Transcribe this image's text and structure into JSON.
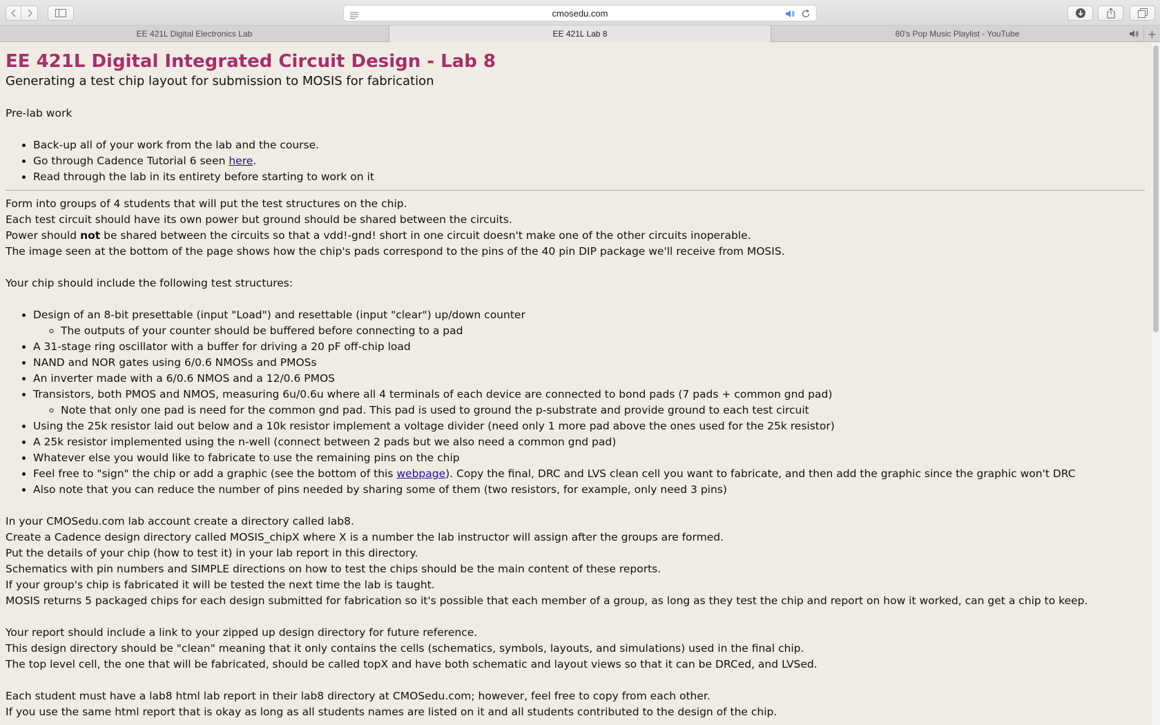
{
  "browser": {
    "url": "cmosedu.com",
    "icons": [
      "back-arrow-icon",
      "forward-arrow-icon",
      "sidebar-icon",
      "reader-icon",
      "audio-icon",
      "reload-icon",
      "download-icon",
      "share-icon",
      "tabs-overview-icon"
    ]
  },
  "tabs": [
    {
      "label": "EE 421L Digital Electronics Lab",
      "active": false
    },
    {
      "label": "EE 421L Lab 8",
      "active": true
    },
    {
      "label": "80's Pop Music Playlist - YouTube",
      "active": false,
      "audio": true
    }
  ],
  "page": {
    "title": "EE 421L Digital Integrated Circuit Design - Lab 8",
    "subtitle": "Generating a test chip layout for submission to MOSIS for fabrication",
    "prelab_heading": "Pre-lab work",
    "prelab_items": {
      "i0": "Back-up all of your work from the lab and the course.",
      "i1_pre": "Go through Cadence Tutorial 6 seen ",
      "i1_link": "here",
      "i1_post": ".",
      "i2": "Read through the lab in its entirety before starting to work on it"
    },
    "para1": {
      "l0": "Form into groups of 4 students that will put the test structures on the chip.",
      "l1": "Each test circuit should have its own power but ground should be shared between the circuits.",
      "l2_pre": "Power should ",
      "l2_bold": "not",
      "l2_post": " be shared between the circuits so that a vdd!-gnd! short in one circuit doesn't make one of the other circuits inoperable.",
      "l3": "The image seen at the bottom of the page shows how the chip's pads correspond to the pins of the 40 pin DIP package we'll receive from MOSIS."
    },
    "structures_heading": "Your chip should include the following test structures:",
    "structures": {
      "s0": "Design of an 8-bit presettable (input \"Load\") and resettable (input \"clear\") up/down counter",
      "s0_sub": "The outputs of your counter should be buffered before connecting to a pad",
      "s1": "A 31-stage ring oscillator with a buffer for driving a 20 pF off-chip load",
      "s2": "NAND and NOR gates using 6/0.6 NMOSs and PMOSs",
      "s3": "An inverter made with a 6/0.6 NMOS and a 12/0.6 PMOS",
      "s4": "Transistors, both PMOS and NMOS, measuring 6u/0.6u where all 4 terminals of each device are connected to bond pads (7 pads + common gnd pad)",
      "s4_sub": "Note that only one pad is need for the common gnd pad. This pad is used to ground the p-substrate and provide ground to each test circuit",
      "s5": "Using the 25k resistor laid out below and a 10k resistor implement a voltage divider (need only 1 more pad above the ones used for the 25k resistor)",
      "s6": "A 25k resistor implemented using the n-well (connect between 2 pads but we also need a common gnd pad)",
      "s7": "Whatever else you would like to fabricate to use the remaining pins on the chip",
      "s8_pre": "Feel free to \"sign\" the chip or add a graphic (see the bottom of this ",
      "s8_link": "webpage",
      "s8_post": "). Copy the final, DRC and LVS clean cell you want to fabricate, and then add the graphic since the graphic won't DRC",
      "s9": "Also note that you can reduce the number of pins needed by sharing some of them (two resistors, for example, only need 3 pins)"
    },
    "para2": {
      "l0": "In your CMOSedu.com lab account create a directory called lab8.",
      "l1": "Create a Cadence design directory called MOSIS_chipX where X is a number the lab instructor will assign after the groups are formed.",
      "l2": "Put the details of your chip (how to test it) in your lab report in this directory.",
      "l3": "Schematics with pin numbers and SIMPLE directions on how to test the chips should be the main content of these reports.",
      "l4": "If your group's chip is fabricated it will be tested the next time the lab is taught.",
      "l5": "MOSIS returns 5 packaged chips for each design submitted for fabrication so it's possible that each member of a group, as long as they test the chip and report on how it worked, can get a chip to keep."
    },
    "para3": {
      "l0": "Your report should include a link to your zipped up design directory for future reference.",
      "l1": "This design directory should be \"clean\" meaning that it only contains the cells (schematics, symbols, layouts, and simulations) used in the final chip.",
      "l2": "The top level cell, the one that will be fabricated, should be called topX and have both schematic and layout views so that it can be DRCed, and LVSed."
    },
    "para4": {
      "l0": "Each student must have a lab8 html lab report in their lab8 directory at CMOSedu.com; however, feel free to copy from each other.",
      "l1": "If you use the same html report that is okay as long as all students names are listed on it and all students contributed to the design of the chip."
    }
  }
}
